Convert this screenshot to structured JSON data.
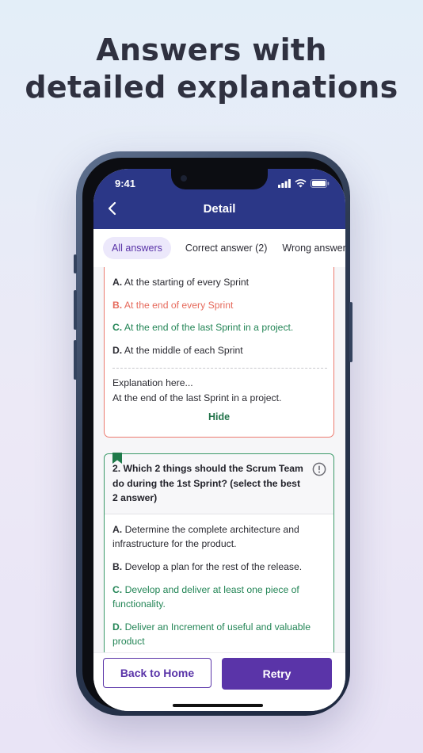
{
  "headline": {
    "line1": "Answers with",
    "line2": "detailed explanations"
  },
  "status_bar": {
    "time": "9:41"
  },
  "header": {
    "title": "Detail"
  },
  "tabs": [
    {
      "label": "All answers",
      "active": true
    },
    {
      "label": "Correct answer (2)",
      "active": false
    },
    {
      "label": "Wrong answer",
      "active": false
    }
  ],
  "question1": {
    "answers": [
      {
        "letter": "A.",
        "text": "At the starting of every Sprint",
        "status": "neutral"
      },
      {
        "letter": "B.",
        "text": "At the end of every Sprint",
        "status": "wrong"
      },
      {
        "letter": "C.",
        "text": "At the end of the last Sprint in a project.",
        "status": "correct"
      },
      {
        "letter": "D.",
        "text": "At the middle of each Sprint",
        "status": "neutral"
      }
    ],
    "explanation_title": "Explanation here...",
    "explanation_text": "At the end of the last Sprint in a project.",
    "hide_label": "Hide"
  },
  "question2": {
    "text_lines": [
      "2. Which 2 things should the Scrum Team",
      "do during the 1st Sprint? (select the best",
      "2 answer)"
    ],
    "answers": [
      {
        "letter": "A.",
        "lines": [
          "Determine the complete architecture and",
          "infrastructure for the product."
        ],
        "status": "neutral"
      },
      {
        "letter": "B.",
        "lines": [
          "Develop a plan for the rest of the release."
        ],
        "status": "neutral"
      },
      {
        "letter": "C.",
        "lines": [
          "Develop and deliver at least one piece of",
          "functionality."
        ],
        "status": "correct"
      },
      {
        "letter": "D.",
        "lines": [
          "Deliver an Increment of useful and valuable",
          "product"
        ],
        "status": "correct"
      }
    ]
  },
  "footer": {
    "back_label": "Back to Home",
    "retry_label": "Retry"
  },
  "colors": {
    "header_bg": "#2b3787",
    "accent": "#5a34a8",
    "correct": "#238556",
    "wrong": "#e66a5c",
    "bookmark": "#1f7a4a"
  },
  "icons": [
    "back-arrow-icon",
    "signal-icon",
    "wifi-icon",
    "battery-icon",
    "bookmark-icon",
    "info-icon"
  ]
}
